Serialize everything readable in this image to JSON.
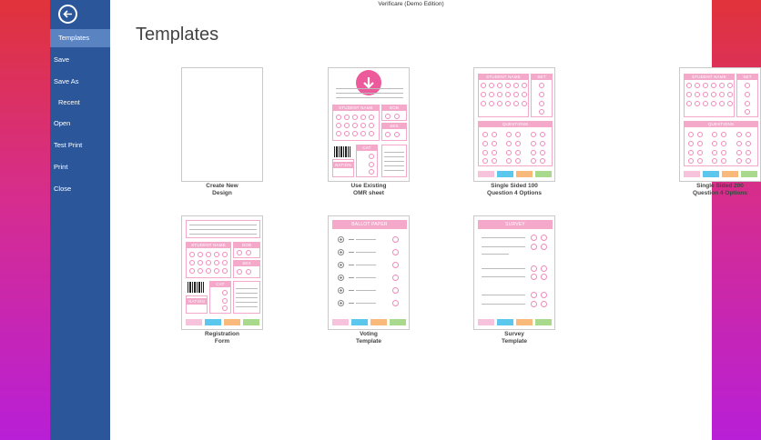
{
  "window_title": "Verificare (Demo Edition)",
  "page_title": "Templates",
  "sidebar": {
    "back_icon": "arrow-left-circle-icon",
    "items": [
      {
        "label": "Templates",
        "active": true
      },
      {
        "label": "Save"
      },
      {
        "label": "Save As"
      },
      {
        "label": "Recent"
      },
      {
        "label": "Open"
      },
      {
        "label": "Test Print"
      },
      {
        "label": "Print"
      },
      {
        "label": "Close"
      }
    ]
  },
  "templates": [
    {
      "label": "Create New\nDesign"
    },
    {
      "label": "Use Existing\nOMR sheet"
    },
    {
      "label": "Single Sided 100\nQuestion 4 Options"
    },
    {
      "label": "Single Sided 200\nQuestion 4 Options"
    },
    {
      "label": "Registration\nForm"
    },
    {
      "label": "Voting\nTemplate"
    },
    {
      "label": "Survey\nTemplate"
    }
  ],
  "thumb_text": {
    "student_name": "STUDENT NAME",
    "dob": "DOB",
    "sex": "SEX",
    "cat": "CAT",
    "nation": "NATION",
    "set": "SET",
    "questions": "QUESTIONS",
    "ballot_paper": "BALLOT PAPER",
    "survey": "SURVEY"
  },
  "colors": {
    "sidebar": "#2b579a",
    "sidebar_active": "#5a83c2",
    "pink": "#f4a9cb",
    "accent_pink": "#ec5a9b",
    "swatch_pink": "#f7c3dc",
    "swatch_blue": "#5bc7ec",
    "swatch_orange": "#f9b97a",
    "swatch_green": "#a9d98d"
  }
}
